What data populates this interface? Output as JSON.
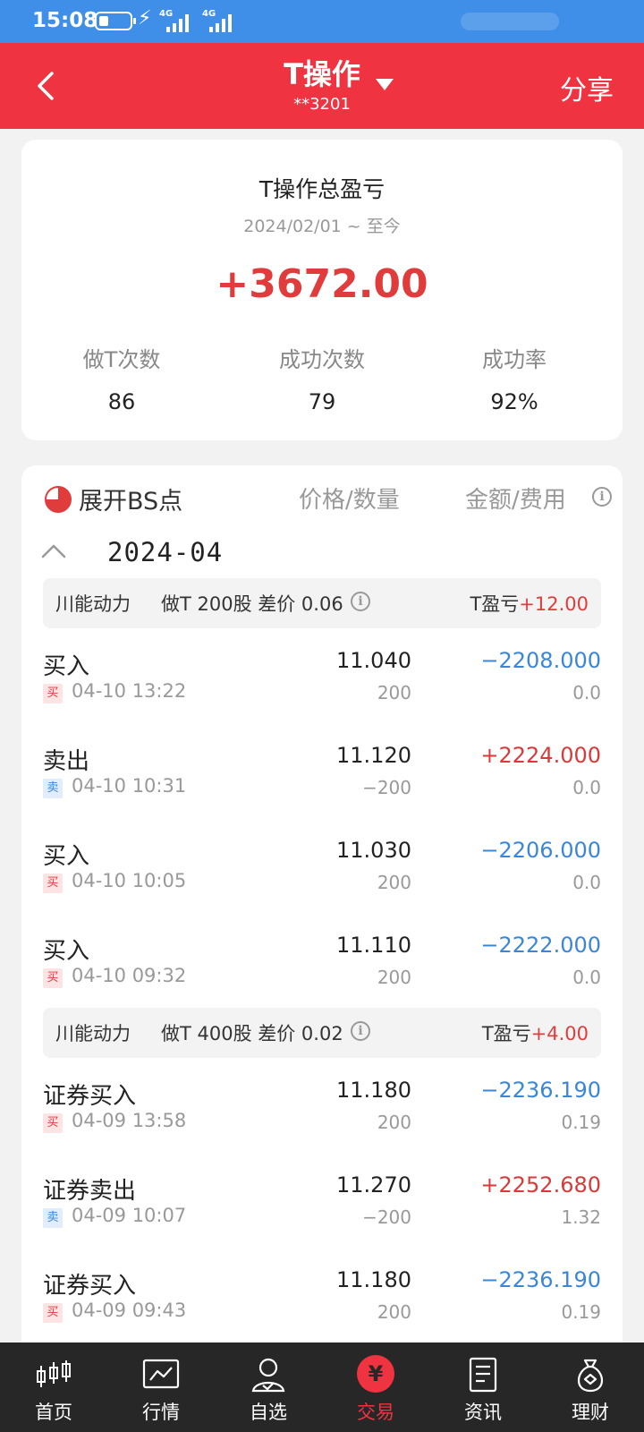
{
  "status_bar": {
    "time": "15:08",
    "net1": "4G",
    "net2": "4G"
  },
  "header": {
    "title": "T操作",
    "account": "**3201",
    "share_label": "分享"
  },
  "summary": {
    "title": "T操作总盈亏",
    "date_range": "2024/02/01 ~ 至今",
    "total_pl": "+3672.00",
    "stats": [
      {
        "label": "做T次数",
        "value": "86"
      },
      {
        "label": "成功次数",
        "value": "79"
      },
      {
        "label": "成功率",
        "value": "92%"
      }
    ]
  },
  "list_header": {
    "expand_label": "展开BS点",
    "col_price": "价格/数量",
    "col_amount": "金额/费用"
  },
  "month": "2024-04",
  "groups": [
    {
      "stock": "川能动力",
      "desc": "做T 200股 差价 0.06",
      "pl_label": "T盈亏",
      "pl_value": "+12.00",
      "rows": [
        {
          "type": "买入",
          "tag": "买",
          "time": "04-10 13:22",
          "price": "11.040",
          "qty": "200",
          "amount": "−2208.000",
          "fee": "0.0"
        },
        {
          "type": "卖出",
          "tag": "卖",
          "time": "04-10 10:31",
          "price": "11.120",
          "qty": "−200",
          "amount": "+2224.000",
          "fee": "0.0"
        },
        {
          "type": "买入",
          "tag": "买",
          "time": "04-10 10:05",
          "price": "11.030",
          "qty": "200",
          "amount": "−2206.000",
          "fee": "0.0"
        },
        {
          "type": "买入",
          "tag": "买",
          "time": "04-10 09:32",
          "price": "11.110",
          "qty": "200",
          "amount": "−2222.000",
          "fee": "0.0"
        }
      ]
    },
    {
      "stock": "川能动力",
      "desc": "做T 400股 差价 0.02",
      "pl_label": "T盈亏",
      "pl_value": "+4.00",
      "rows": [
        {
          "type": "证券买入",
          "tag": "买",
          "time": "04-09 13:58",
          "price": "11.180",
          "qty": "200",
          "amount": "−2236.190",
          "fee": "0.19"
        },
        {
          "type": "证券卖出",
          "tag": "卖",
          "time": "04-09 10:07",
          "price": "11.270",
          "qty": "−200",
          "amount": "+2252.680",
          "fee": "1.32"
        },
        {
          "type": "证券买入",
          "tag": "买",
          "time": "04-09 09:43",
          "price": "11.180",
          "qty": "200",
          "amount": "−2236.190",
          "fee": "0.19"
        }
      ]
    }
  ],
  "bottom_nav": [
    {
      "label": "首页",
      "icon": "candlestick-icon"
    },
    {
      "label": "行情",
      "icon": "chart-icon"
    },
    {
      "label": "自选",
      "icon": "person-icon"
    },
    {
      "label": "交易",
      "icon": "yen-icon",
      "active": true
    },
    {
      "label": "资讯",
      "icon": "document-icon"
    },
    {
      "label": "理财",
      "icon": "moneybag-icon"
    }
  ],
  "colors": {
    "header": "#ef3340",
    "status": "#3f8ee8",
    "rise": "#e03c3c",
    "fall": "#3a86d8",
    "nav_bg": "#272727"
  }
}
